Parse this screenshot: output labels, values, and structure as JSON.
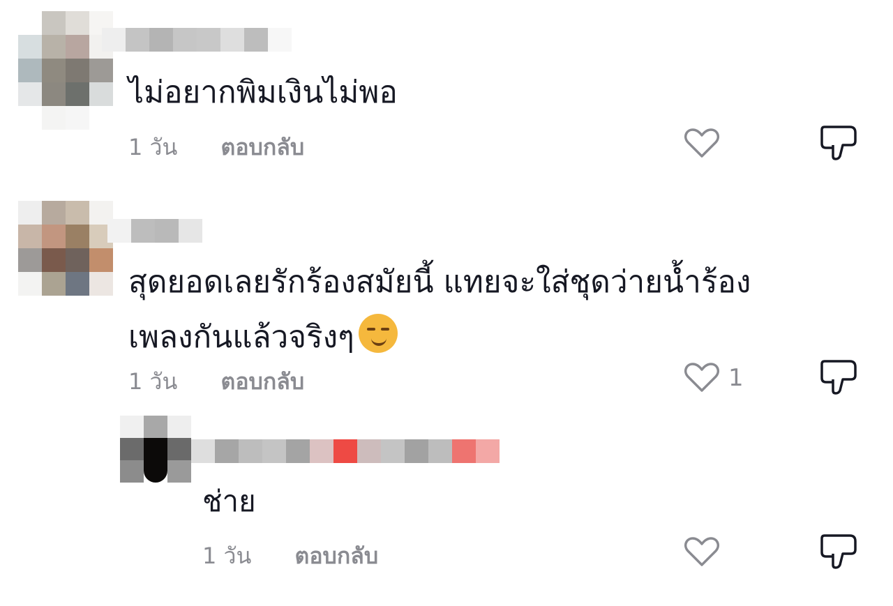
{
  "comments": [
    {
      "text": "ไม่อยากพิมเงินไม่พอ",
      "time": "1 วัน",
      "reply_label": "ตอบกลับ",
      "likes": ""
    },
    {
      "text_line1": "สุดยอดเลยรักร้องสมัยนี้ แทยจะใส่ชุดว่ายน้ำร้อง",
      "text_line2": "เพลงกันแล้วจริงๆ",
      "emoji": "smirking-face",
      "time": "1 วัน",
      "reply_label": "ตอบกลับ",
      "likes": "1"
    }
  ],
  "reply": {
    "text": "ช่าย",
    "time": "1 วัน",
    "reply_label": "ตอบกลับ",
    "likes": ""
  },
  "icons": {
    "like": "heart-outline-icon",
    "dislike": "thumbs-down-outline-icon"
  },
  "colors": {
    "text": "#161823",
    "meta": "#8a8b91"
  }
}
